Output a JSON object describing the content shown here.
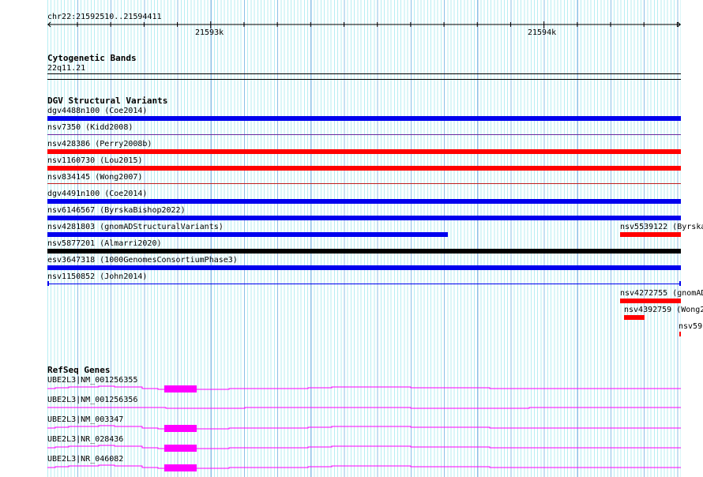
{
  "ruler": {
    "region": "chr22:21592510..21594411",
    "ticks": [
      "21593k",
      "21594k"
    ]
  },
  "tracks": {
    "cytoband": {
      "title": "Cytogenetic Bands",
      "band": "22q11.21"
    },
    "dgv": {
      "title": "DGV Structural Variants",
      "features": [
        {
          "label": "dgv4488n100 (Coe2014)",
          "color": "#0000ee"
        },
        {
          "label": "nsv7350 (Kidd2008)",
          "color": "#6a2aa0"
        },
        {
          "label": "nsv428386 (Perry2008b)",
          "color": "#ff0000"
        },
        {
          "label": "nsv1160730 (Lou2015)",
          "color": "#ff0000"
        },
        {
          "label": "nsv834145 (Wong2007)",
          "color": "#c02020"
        },
        {
          "label": "dgv4491n100 (Coe2014)",
          "color": "#0000ee"
        },
        {
          "label": "nsv6146567 (ByrskaBishop2022)",
          "color": "#0000ee"
        },
        {
          "label": "nsv4281803 (gnomADStructuralVariants)",
          "color": "#0000ee"
        },
        {
          "label": "nsv5539122 (Byrska",
          "color": "#ff0000"
        },
        {
          "label": "nsv5877201 (Almarri2020)",
          "color": "#000000"
        },
        {
          "label": "esv3647318 (1000GenomesConsortiumPhase3)",
          "color": "#0000ee"
        },
        {
          "label": "nsv1150852 (John2014)",
          "color": "#0000ee"
        },
        {
          "label": "nsv4272755 (gnomAD",
          "color": "#ff0000"
        },
        {
          "label": "nsv4392759 (Wong2",
          "color": "#ff0000"
        },
        {
          "label": "nsv59",
          "color": "#ff0000"
        }
      ]
    },
    "refseq": {
      "title": "RefSeq Genes",
      "genes": [
        {
          "label": "UBE2L3|NM_001256355"
        },
        {
          "label": "UBE2L3|NM_001256356"
        },
        {
          "label": "UBE2L3|NM_003347"
        },
        {
          "label": "UBE2L3|NR_028436"
        },
        {
          "label": "UBE2L3|NR_046082"
        }
      ],
      "color": "#ff00ff"
    }
  }
}
